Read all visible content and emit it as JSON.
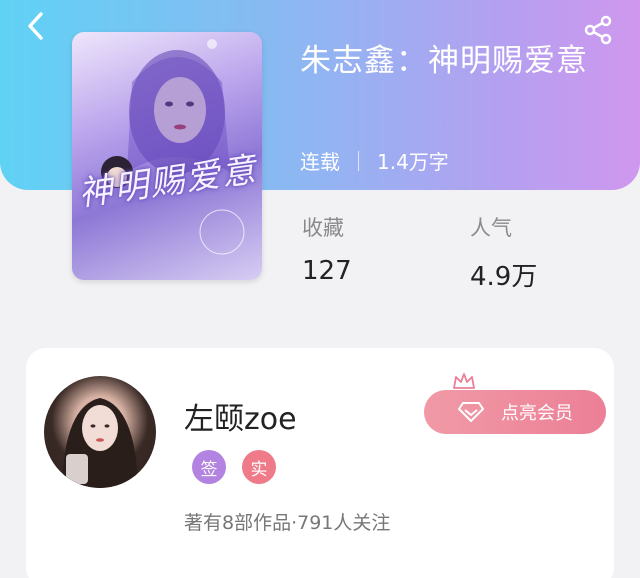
{
  "colors": {
    "header_gradient": [
      "#5fd2f4",
      "#cf98ee"
    ],
    "vip_button": "#ec7f96",
    "badge_sign": "#b283e0",
    "badge_real": "#ef7b8a"
  },
  "header": {
    "back_icon": "chevron-left-icon",
    "share_icon": "share-icon"
  },
  "book": {
    "cover_text": "神明赐爱意",
    "title": "朱志鑫：神明赐爱意",
    "status": "连载",
    "word_count": "1.4万字"
  },
  "stats": {
    "favorites_label": "收藏",
    "favorites_value": "127",
    "popularity_label": "人气",
    "popularity_value": "4.9万"
  },
  "author": {
    "name": "左颐zoe",
    "badge_sign": "签",
    "badge_real": "实",
    "vip_label": "点亮会员",
    "summary": "著有8部作品·791人关注"
  }
}
